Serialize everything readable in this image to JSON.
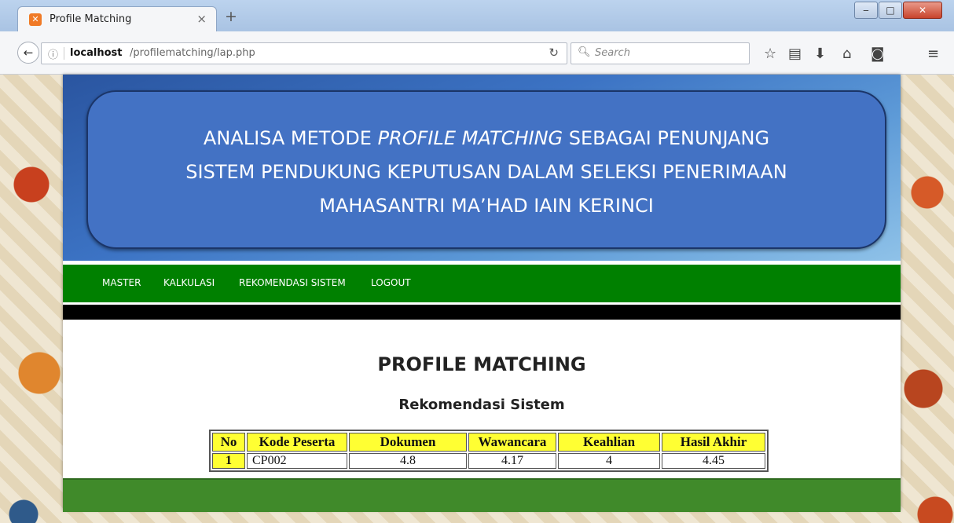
{
  "browser": {
    "tab_title": "Profile Matching",
    "tab_close": "×",
    "new_tab": "+",
    "url_host": "localhost",
    "url_path": "/profilematching/lap.php",
    "search_placeholder": "Search"
  },
  "banner": {
    "line1_pre": "ANALISA METODE ",
    "line1_em": "PROFILE MATCHING",
    "line1_post": " SEBAGAI PENUNJANG",
    "line2": "SISTEM PENDUKUNG KEPUTUSAN DALAM SELEKSI PENERIMAAN",
    "line3": "MAHASANTRI MA’HAD IAIN KERINCI"
  },
  "menu": [
    "MASTER",
    "KALKULASI",
    "REKOMENDASI SISTEM",
    "LOGOUT"
  ],
  "page": {
    "title": "PROFILE MATCHING",
    "subtitle": "Rekomendasi Sistem"
  },
  "table": {
    "headers": [
      "No",
      "Kode Peserta",
      "Dokumen",
      "Wawancara",
      "Keahlian",
      "Hasil Akhir"
    ],
    "rows": [
      [
        "1",
        "CP002",
        "4.8",
        "4.17",
        "4",
        "4.45"
      ]
    ]
  }
}
